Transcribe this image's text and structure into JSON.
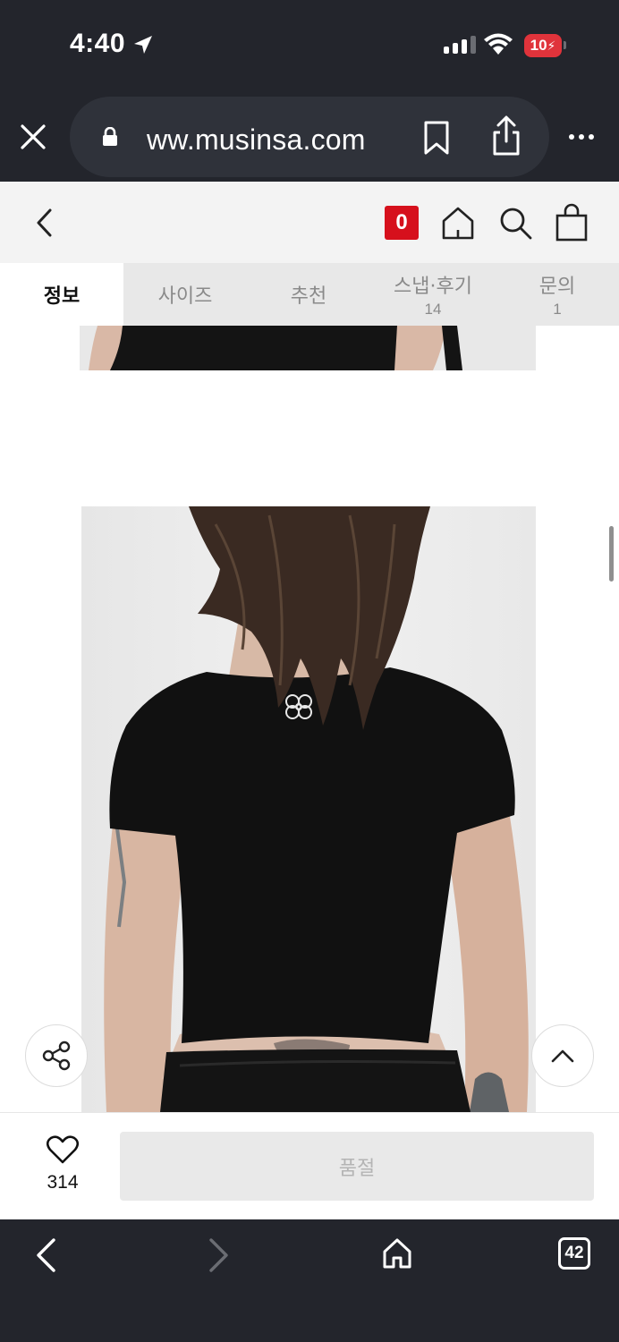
{
  "status_bar": {
    "time": "4:40",
    "battery_level": "10",
    "signal_bars_filled": 3,
    "signal_bars_total": 4
  },
  "browser": {
    "url": "ww.musinsa.com",
    "tab_count": "42",
    "icons": [
      "close-icon",
      "lock-icon",
      "bookmark-icon",
      "share-icon",
      "more-icon",
      "back-icon",
      "forward-icon",
      "home-icon",
      "tabs-icon"
    ]
  },
  "site_header": {
    "recent_count": "0",
    "icons": [
      "chevron-left-icon",
      "home-icon",
      "search-icon",
      "bag-icon"
    ]
  },
  "tabs": [
    {
      "label": "정보",
      "count": "",
      "active": true
    },
    {
      "label": "사이즈",
      "count": "",
      "active": false
    },
    {
      "label": "추천",
      "count": "",
      "active": false
    },
    {
      "label": "스냅·후기",
      "count": "14",
      "active": false
    },
    {
      "label": "문의",
      "count": "1",
      "active": false
    }
  ],
  "purchase_bar": {
    "like_count": "314",
    "buy_button_label": "품절"
  },
  "colors": {
    "chrome_dark": "#23252c",
    "accent_red": "#d6101c",
    "tab_bg": "#e8e8e8",
    "soldout_bg": "#e9e9e9"
  }
}
